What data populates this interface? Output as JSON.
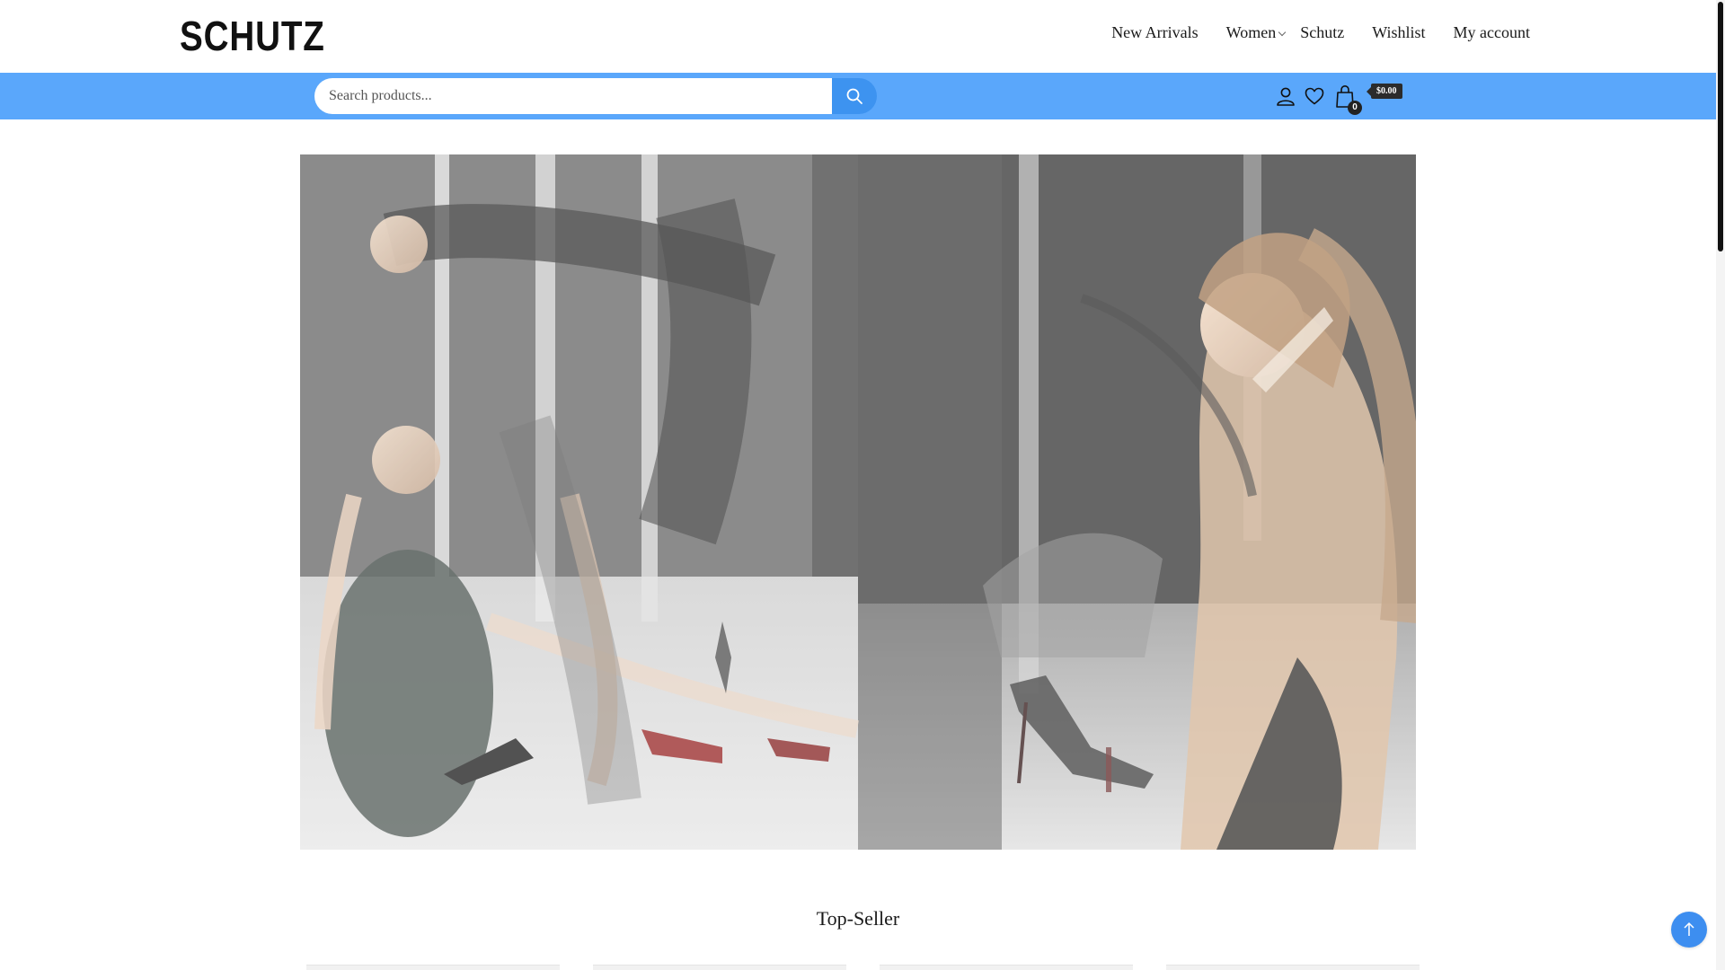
{
  "brand": {
    "logo_text": "SCHUTZ"
  },
  "nav": {
    "items": [
      {
        "label": "New Arrivals",
        "has_dropdown": false
      },
      {
        "label": "Women",
        "has_dropdown": true
      },
      {
        "label": "Schutz",
        "has_dropdown": false
      },
      {
        "label": "Wishlist",
        "has_dropdown": false
      },
      {
        "label": "My account",
        "has_dropdown": false
      }
    ]
  },
  "search": {
    "placeholder": "Search products...",
    "value": ""
  },
  "header_icons": {
    "account": "user-icon",
    "wishlist": "heart-icon",
    "cart": "shopping-bag-icon"
  },
  "cart": {
    "count": "0",
    "total": "$0.00"
  },
  "hero": {
    "alt": ""
  },
  "sections": {
    "top_seller_title": "Top-Seller"
  },
  "colors": {
    "search_band": "#5aa7fb",
    "search_button": "#3d93f0",
    "back_to_top": "#3d8ef0"
  }
}
